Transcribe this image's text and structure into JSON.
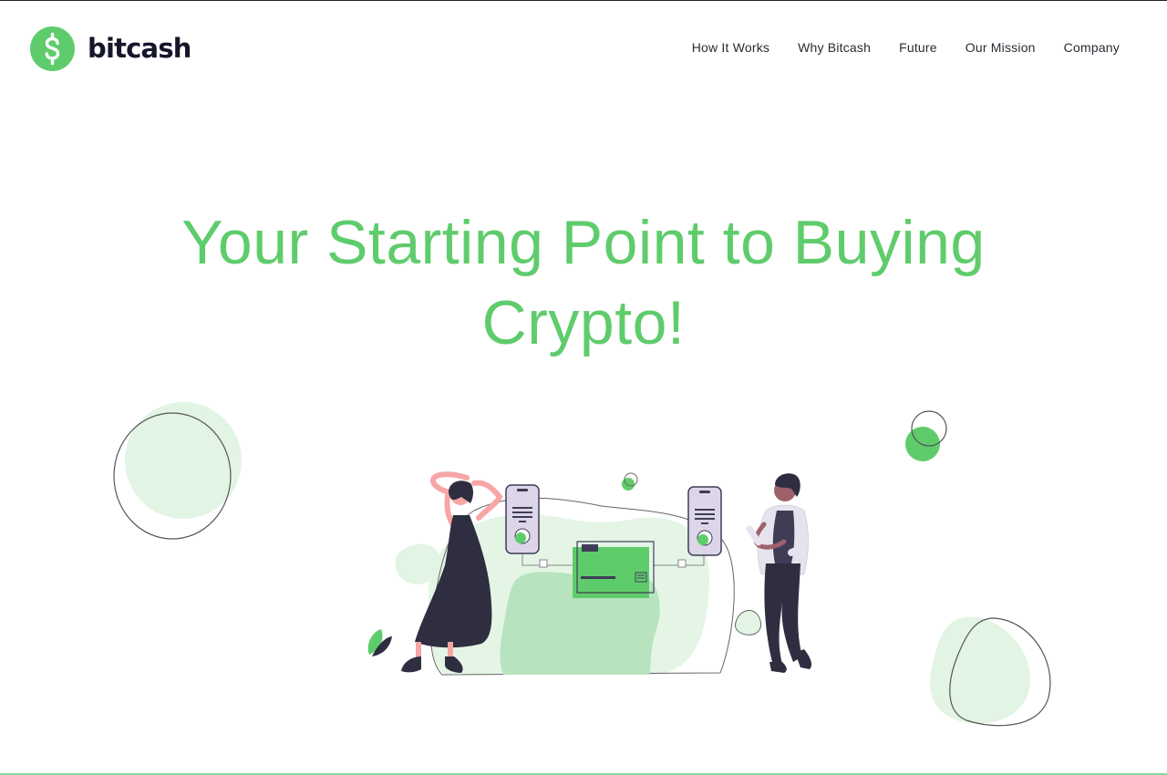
{
  "brand": {
    "name": "bitcash",
    "icon": "dollar-icon",
    "color": "#5fcc6c"
  },
  "nav": {
    "items": [
      {
        "label": "How It Works"
      },
      {
        "label": "Why Bitcash"
      },
      {
        "label": "Future"
      },
      {
        "label": "Our Mission"
      },
      {
        "label": "Company"
      }
    ]
  },
  "hero": {
    "title": "Your Starting Point to Buying Crypto!",
    "accent_color": "#5fcc6c"
  },
  "illustration": {
    "icons": [
      "woman-figure",
      "man-figure",
      "phone-icon",
      "card-icon",
      "blob-shape"
    ]
  }
}
